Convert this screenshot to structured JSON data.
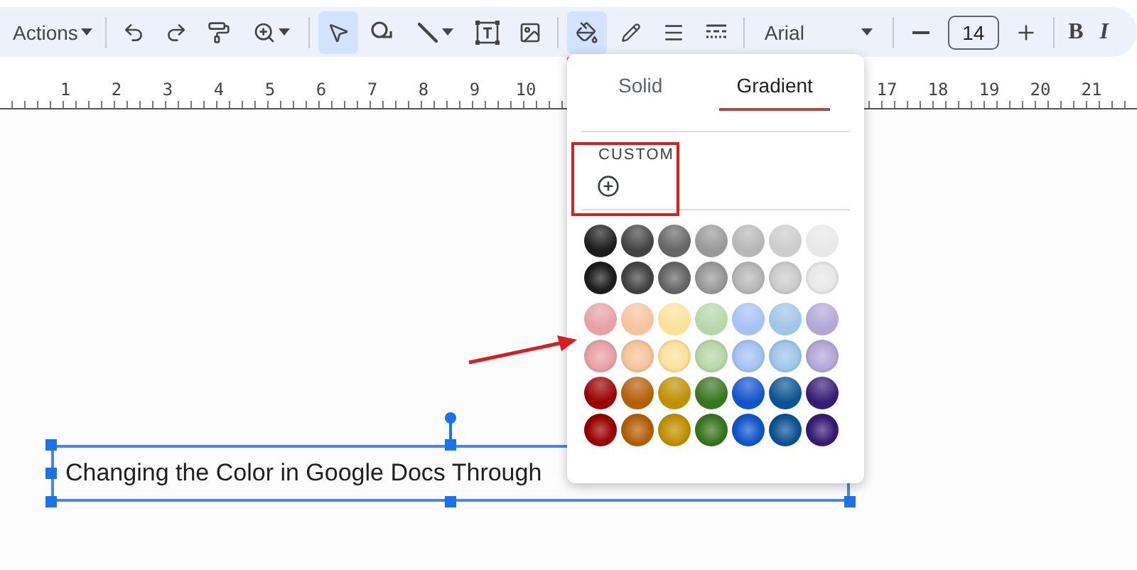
{
  "toolbar": {
    "actions_label": "Actions",
    "select_tool_selected": true,
    "fill_tool_selected": true,
    "font": "Arial",
    "font_size": "14",
    "bold_label": "B",
    "italic_label": "I"
  },
  "ruler": {
    "left_numbers": [
      "1",
      "2",
      "3",
      "4",
      "5",
      "6",
      "7",
      "8",
      "9",
      "10"
    ],
    "right_numbers": [
      "17",
      "18",
      "19",
      "20",
      "21"
    ]
  },
  "fill_popup": {
    "tabs": [
      {
        "label": "Solid",
        "selected": false
      },
      {
        "label": "Gradient",
        "selected": true
      }
    ],
    "custom_label": "CUSTOM",
    "swatch_rows": [
      {
        "kind": "top-light",
        "swatches": [
          {
            "color": "#1c1c1c"
          },
          {
            "color": "#434343"
          },
          {
            "color": "#666666"
          },
          {
            "color": "#999999"
          },
          {
            "color": "#b7b7b7"
          },
          {
            "color": "#cccccc"
          },
          {
            "color": "#e8e8e8"
          }
        ]
      },
      {
        "kind": "center-light",
        "swatches": [
          {
            "color": "#1c1c1c"
          },
          {
            "color": "#434343"
          },
          {
            "color": "#666666"
          },
          {
            "color": "#999999"
          },
          {
            "color": "#b7b7b7"
          },
          {
            "color": "#cccccc"
          },
          {
            "color": "#e8e8e8"
          }
        ]
      },
      {
        "kind": "top-light",
        "swatches": [
          {
            "color": "#e6a1a6"
          },
          {
            "color": "#f5c49b"
          },
          {
            "color": "#fbe199"
          },
          {
            "color": "#b6d7a8"
          },
          {
            "color": "#a4c2f4"
          },
          {
            "color": "#9fc5e8"
          },
          {
            "color": "#b4a7d6"
          }
        ]
      },
      {
        "kind": "center-light",
        "swatches": [
          {
            "color": "#e6a1a6"
          },
          {
            "color": "#f5c49b"
          },
          {
            "color": "#fbe199"
          },
          {
            "color": "#b6d7a8"
          },
          {
            "color": "#a4c2f4"
          },
          {
            "color": "#9fc5e8"
          },
          {
            "color": "#b4a7d6"
          }
        ]
      },
      {
        "kind": "top-light",
        "swatches": [
          {
            "color": "#990000"
          },
          {
            "color": "#b45f06"
          },
          {
            "color": "#bf9000"
          },
          {
            "color": "#38761d"
          },
          {
            "color": "#1155cc"
          },
          {
            "color": "#0b5394"
          },
          {
            "color": "#351c75"
          }
        ]
      },
      {
        "kind": "center-light",
        "swatches": [
          {
            "color": "#990000"
          },
          {
            "color": "#b45f06"
          },
          {
            "color": "#bf9000"
          },
          {
            "color": "#38761d"
          },
          {
            "color": "#1155cc"
          },
          {
            "color": "#0b5394"
          },
          {
            "color": "#351c75"
          }
        ]
      }
    ]
  },
  "text_box": {
    "text": "Changing the Color in Google Docs Through"
  }
}
